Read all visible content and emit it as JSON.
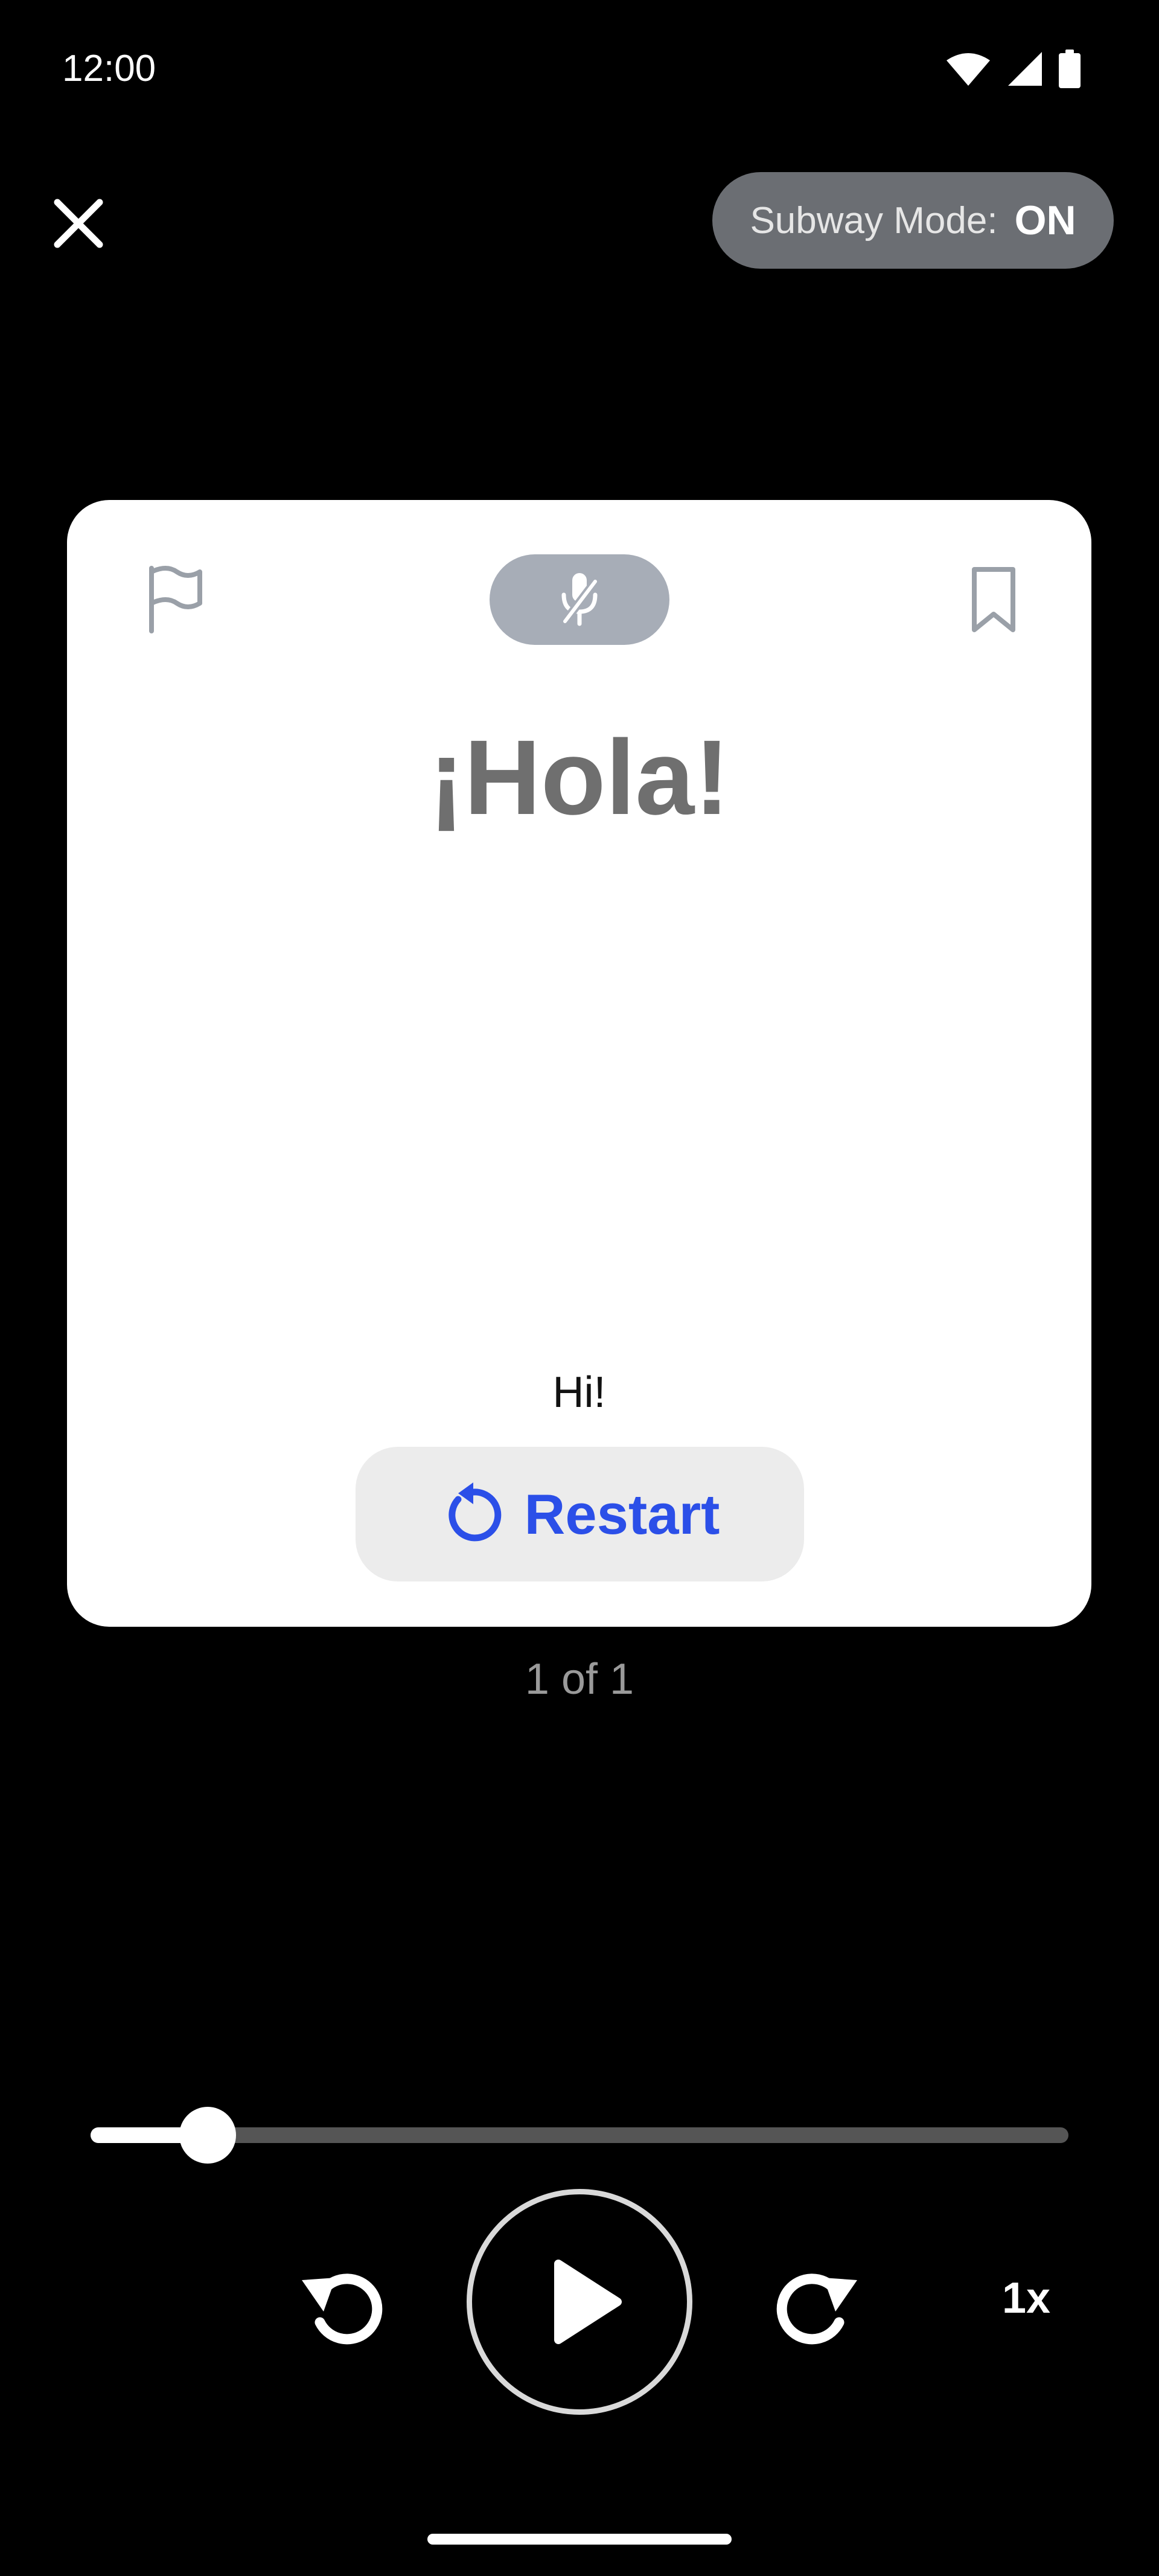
{
  "status_bar": {
    "time": "12:00",
    "icons": [
      "wifi-icon",
      "signal-icon",
      "battery-icon"
    ]
  },
  "top_bar": {
    "close_icon": "close-icon",
    "subway_mode_label": "Subway Mode:",
    "subway_mode_value": "ON"
  },
  "card": {
    "flag_icon": "flag-icon",
    "mic_icon": "mic-off-icon",
    "bookmark_icon": "bookmark-icon",
    "word": "¡Hola!",
    "translation": "Hi!",
    "restart_label": "Restart",
    "restart_icon": "restart-icon"
  },
  "counter": "1 of 1",
  "player": {
    "progress": 0.12,
    "rewind_icon": "rewind-icon",
    "play_icon": "play-icon",
    "forward_icon": "forward-icon",
    "speed": "1x"
  },
  "colors": {
    "accent": "#2b4fe8",
    "background": "#000000",
    "card": "#ffffff",
    "pill": "#6b6e73"
  }
}
